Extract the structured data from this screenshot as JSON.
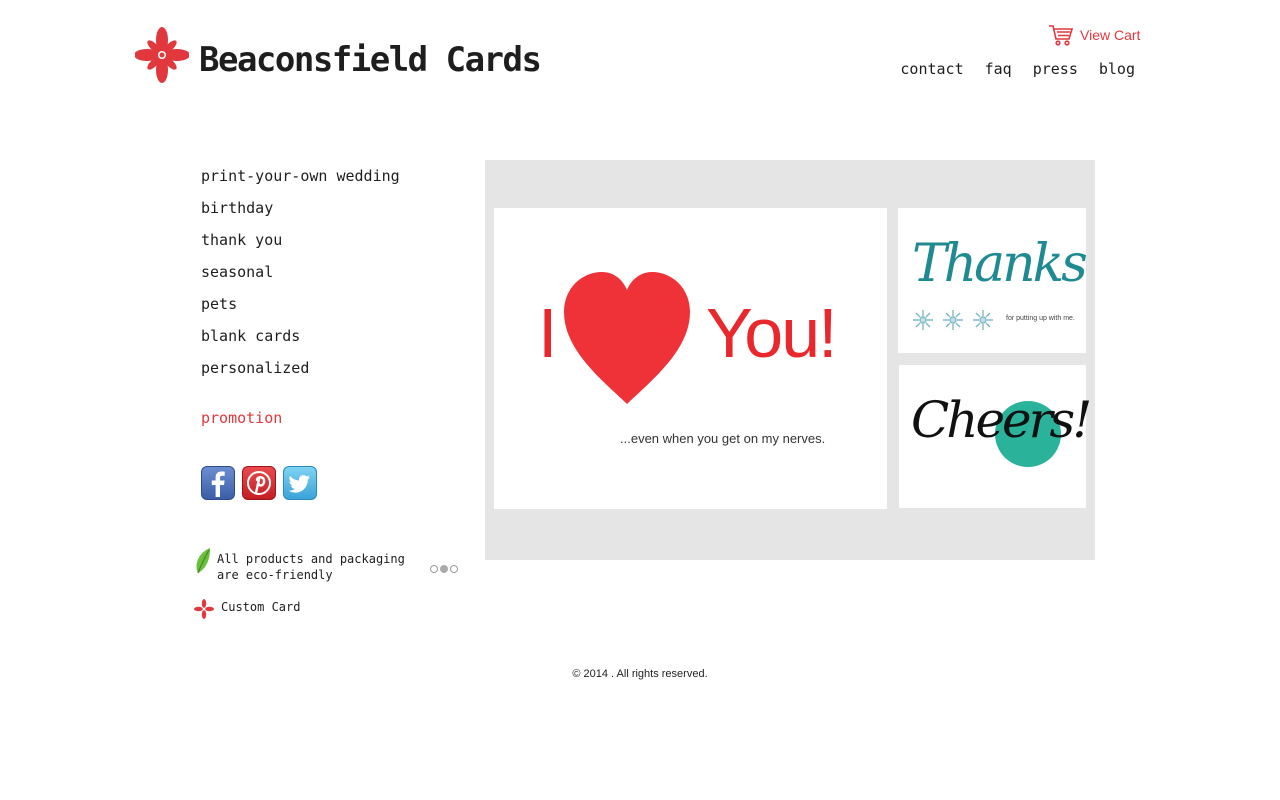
{
  "header": {
    "brand": "Beaconsfield Cards",
    "cart_label": "View Cart",
    "nav": [
      "contact",
      "faq",
      "press",
      "blog"
    ]
  },
  "sidebar": {
    "items": [
      "print-your-own wedding",
      "birthday",
      "thank you",
      "seasonal",
      "pets",
      "blank cards",
      "personalized"
    ],
    "promotion": "promotion",
    "social": [
      "facebook-icon",
      "pinterest-icon",
      "twitter-icon"
    ],
    "eco_line1": "All products and packaging",
    "eco_line2": "are eco-friendly",
    "custom_card": "Custom Card"
  },
  "slider": {
    "dot_count": 3,
    "active_index": 1
  },
  "cards": {
    "main": {
      "i": "I",
      "you": "You!",
      "subtitle": "...even when you get on my nerves."
    },
    "thanks": {
      "word": "Thanks",
      "subtitle": "for putting up with me."
    },
    "cheers": {
      "word": "Cheers!"
    }
  },
  "footer": {
    "copyright": "© 2014 . All rights reserved."
  },
  "colors": {
    "accent": "#e0383d",
    "gallery_bg": "#e5e5e5",
    "thanks_teal": "#1f8a92",
    "cheers_green": "#2ab29b"
  }
}
